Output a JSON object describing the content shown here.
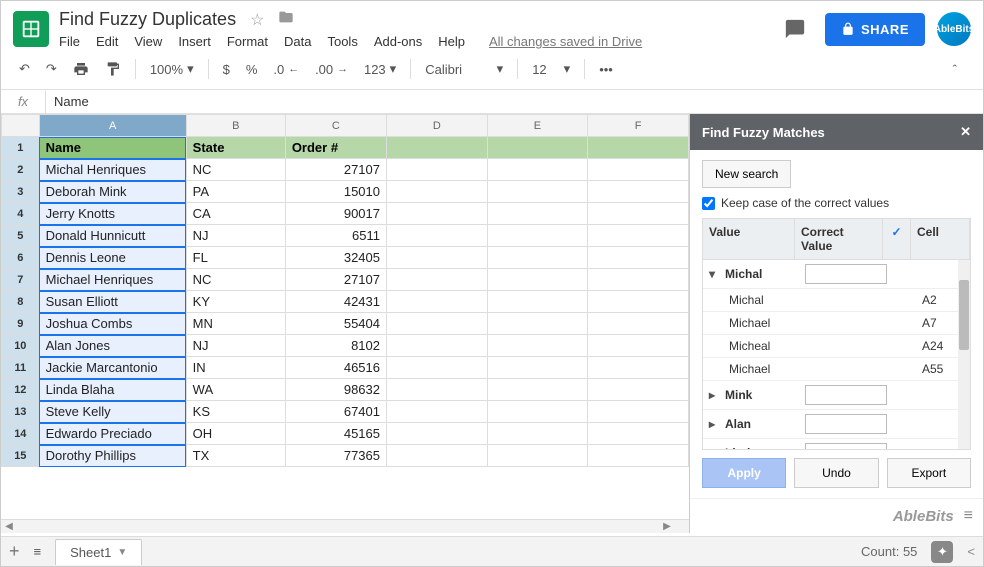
{
  "header": {
    "title": "Find Fuzzy Duplicates",
    "menus": [
      "File",
      "Edit",
      "View",
      "Insert",
      "Format",
      "Data",
      "Tools",
      "Add-ons",
      "Help"
    ],
    "saved_text": "All changes saved in Drive",
    "share_label": "SHARE",
    "avatar_text": "AbleBits"
  },
  "toolbar": {
    "zoom": "100%",
    "currency": "$",
    "percent": "%",
    "dec_dec": ".0",
    "dec_inc": ".00",
    "num_fmt": "123",
    "font": "Calibri",
    "font_size": "12",
    "more": "•••"
  },
  "fx": {
    "label": "fx",
    "value": "Name"
  },
  "sheet": {
    "columns": [
      "A",
      "B",
      "C",
      "D",
      "E",
      "F"
    ],
    "sel_col": 0,
    "headers": {
      "a": "Name",
      "b": "State",
      "c": "Order #"
    },
    "rows": [
      {
        "n": "2",
        "a": "Michal Henriques",
        "b": "NC",
        "c": "27107"
      },
      {
        "n": "3",
        "a": "Deborah Mink",
        "b": "PA",
        "c": "15010"
      },
      {
        "n": "4",
        "a": "Jerry Knotts",
        "b": "CA",
        "c": "90017"
      },
      {
        "n": "5",
        "a": "Donald Hunnicutt",
        "b": "NJ",
        "c": "6511"
      },
      {
        "n": "6",
        "a": "Dennis Leone",
        "b": "FL",
        "c": "32405"
      },
      {
        "n": "7",
        "a": "Michael Henriques",
        "b": "NC",
        "c": "27107"
      },
      {
        "n": "8",
        "a": "Susan Elliott",
        "b": "KY",
        "c": "42431"
      },
      {
        "n": "9",
        "a": "Joshua Combs",
        "b": "MN",
        "c": "55404"
      },
      {
        "n": "10",
        "a": "Alan Jones",
        "b": "NJ",
        "c": "8102"
      },
      {
        "n": "11",
        "a": "Jackie Marcantonio",
        "b": "IN",
        "c": "46516"
      },
      {
        "n": "12",
        "a": "Linda Blaha",
        "b": "WA",
        "c": "98632"
      },
      {
        "n": "13",
        "a": "Steve Kelly",
        "b": "KS",
        "c": "67401"
      },
      {
        "n": "14",
        "a": "Edwardo Preciado",
        "b": "OH",
        "c": "45165"
      },
      {
        "n": "15",
        "a": "Dorothy Phillips",
        "b": "TX",
        "c": "77365"
      }
    ]
  },
  "tabs": {
    "sheet1": "Sheet1",
    "count": "Count: 55"
  },
  "panel": {
    "title": "Find Fuzzy Matches",
    "new_search": "New search",
    "keep_case": "Keep case of the correct values",
    "headers": {
      "value": "Value",
      "correct": "Correct Value",
      "cell": "Cell"
    },
    "groups": [
      {
        "name": "Michal",
        "expanded": true,
        "correct": "",
        "items": [
          {
            "val": "Michal",
            "cell": "A2"
          },
          {
            "val": "Michael",
            "cell": "A7"
          },
          {
            "val": "Micheal",
            "cell": "A24"
          },
          {
            "val": "Michael",
            "cell": "A55"
          }
        ]
      },
      {
        "name": "Mink",
        "expanded": false,
        "correct": ""
      },
      {
        "name": "Alan",
        "expanded": false,
        "correct": ""
      },
      {
        "name": "Linda",
        "expanded": false,
        "correct": ""
      }
    ],
    "apply": "Apply",
    "undo": "Undo",
    "export": "Export",
    "brand": "AbleBits"
  }
}
